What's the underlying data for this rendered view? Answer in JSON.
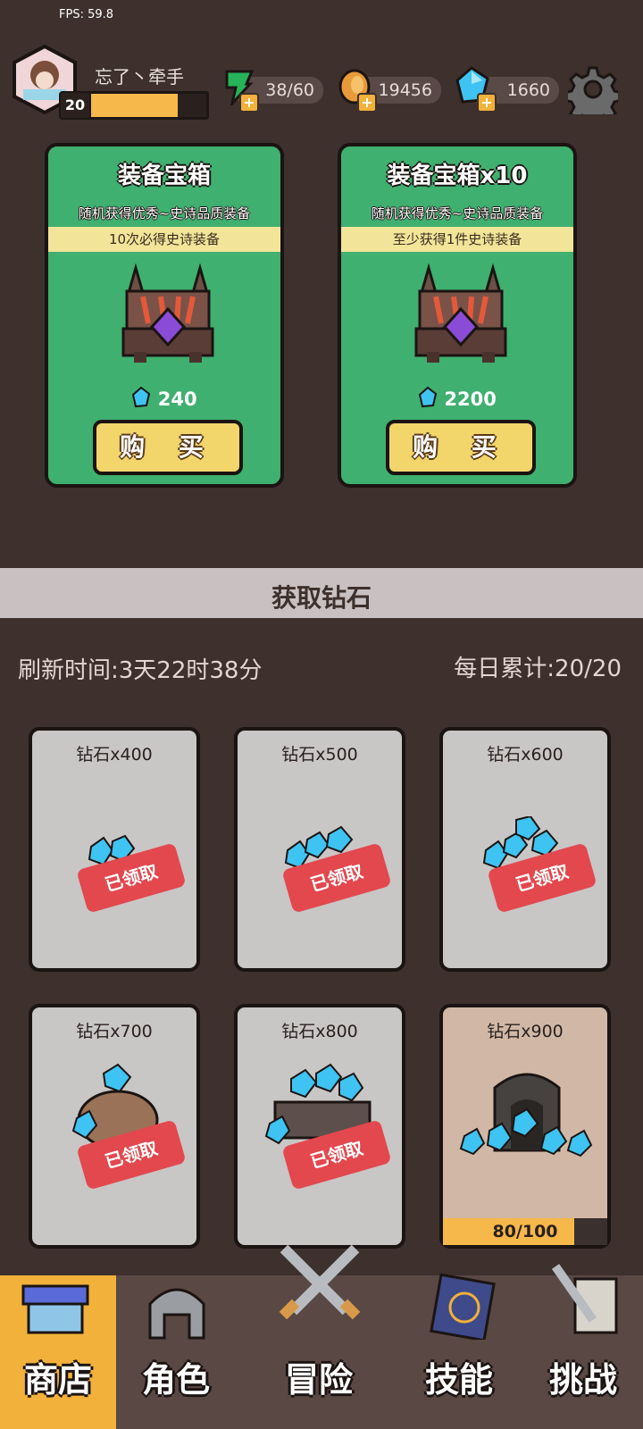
{
  "fps": "FPS: 59.8",
  "player": {
    "name": "忘了丶牵手",
    "level": "20",
    "xp_fraction": 0.76
  },
  "resources": {
    "energy": "38/60",
    "coins": "19456",
    "gems": "1660"
  },
  "chests": [
    {
      "title": "装备宝箱",
      "desc": "随机获得优秀~史诗品质装备",
      "band": "10次必得史诗装备",
      "price": "240",
      "button": "购 买"
    },
    {
      "title": "装备宝箱x10",
      "desc": "随机获得优秀~史诗品质装备",
      "band": "至少获得1件史诗装备",
      "price": "2200",
      "button": "购 买"
    }
  ],
  "banner": "获取钻石",
  "refresh": "刷新时间:3天22时38分",
  "daily": "每日累计:20/20",
  "gems": [
    {
      "label": "钻石x400",
      "status": "已领取"
    },
    {
      "label": "钻石x500",
      "status": "已领取"
    },
    {
      "label": "钻石x600",
      "status": "已领取"
    },
    {
      "label": "钻石x700",
      "status": "已领取"
    },
    {
      "label": "钻石x800",
      "status": "已领取"
    },
    {
      "label": "钻石x900",
      "progress": "80/100",
      "progress_fraction": 0.8
    }
  ],
  "nav": [
    "商店",
    "角色",
    "冒险",
    "技能",
    "挑战"
  ],
  "colors": {
    "accent": "#3fb070",
    "gold": "#f2d56b",
    "claimed": "#e2484e"
  }
}
